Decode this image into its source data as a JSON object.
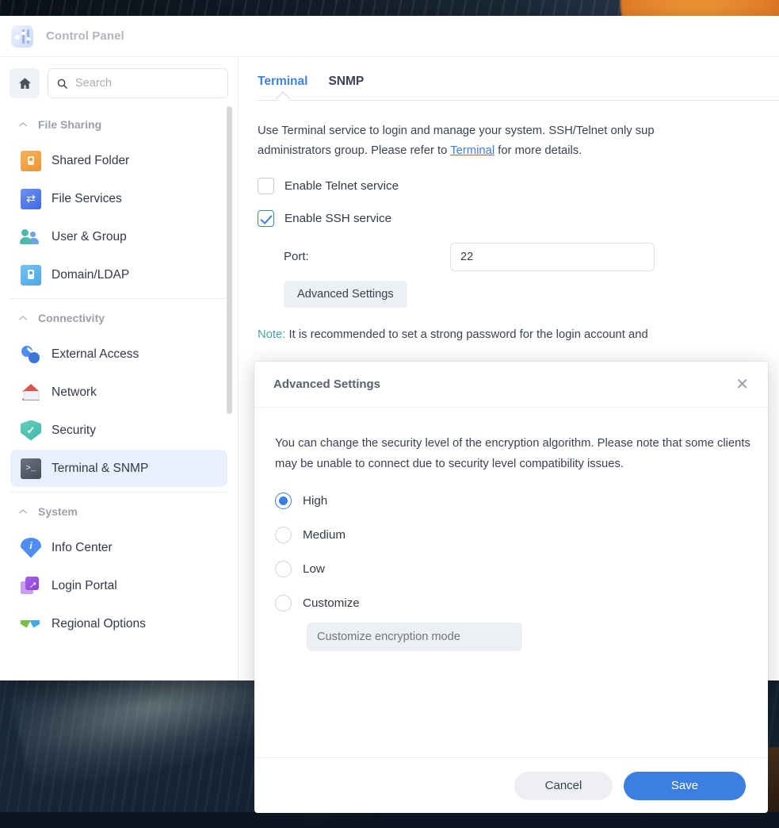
{
  "window": {
    "title": "Control Panel",
    "app_icon": "control-panel-icon"
  },
  "sidebar": {
    "home_icon": "home-icon",
    "search": {
      "placeholder": "Search",
      "value": "",
      "icon": "search-icon"
    },
    "groups": [
      {
        "label": "File Sharing",
        "chevron": "chevron-up-icon",
        "items": [
          {
            "label": "Shared Folder",
            "icon": "shared-folder-icon",
            "selected": false
          },
          {
            "label": "File Services",
            "icon": "file-services-icon",
            "selected": false
          },
          {
            "label": "User & Group",
            "icon": "user-group-icon",
            "selected": false
          },
          {
            "label": "Domain/LDAP",
            "icon": "domain-ldap-icon",
            "selected": false
          }
        ]
      },
      {
        "label": "Connectivity",
        "chevron": "chevron-up-icon",
        "items": [
          {
            "label": "External Access",
            "icon": "external-access-icon",
            "selected": false
          },
          {
            "label": "Network",
            "icon": "network-icon",
            "selected": false
          },
          {
            "label": "Security",
            "icon": "security-shield-icon",
            "selected": false
          },
          {
            "label": "Terminal & SNMP",
            "icon": "terminal-icon",
            "selected": true
          }
        ]
      },
      {
        "label": "System",
        "chevron": "chevron-up-icon",
        "items": [
          {
            "label": "Info Center",
            "icon": "info-center-icon",
            "selected": false
          },
          {
            "label": "Login Portal",
            "icon": "login-portal-icon",
            "selected": false
          },
          {
            "label": "Regional Options",
            "icon": "regional-options-icon",
            "selected": false
          }
        ]
      }
    ]
  },
  "main": {
    "tabs": [
      {
        "label": "Terminal",
        "active": true
      },
      {
        "label": "SNMP",
        "active": false
      }
    ],
    "description_part1": "Use Terminal service to login and manage your system. SSH/Telnet only sup",
    "description_part2": "administrators group. Please refer to ",
    "description_link": "Terminal",
    "description_part3": " for more details.",
    "telnet_checkbox": {
      "label": "Enable Telnet service",
      "checked": false
    },
    "ssh_checkbox": {
      "label": "Enable SSH service",
      "checked": true
    },
    "port": {
      "label": "Port:",
      "value": "22"
    },
    "advanced_button": "Advanced Settings",
    "note_prefix": "Note:",
    "note_text": " It is recommended to set a strong password for the login account and"
  },
  "modal": {
    "title": "Advanced Settings",
    "close_icon": "close-icon",
    "description": "You can change the security level of the encryption algorithm. Please note that some clients may be unable to connect due to security level compatibility issues.",
    "options": [
      {
        "label": "High",
        "selected": true
      },
      {
        "label": "Medium",
        "selected": false
      },
      {
        "label": "Low",
        "selected": false
      },
      {
        "label": "Customize",
        "selected": false
      }
    ],
    "customize_input": {
      "placeholder": "Customize encryption mode",
      "value": ""
    },
    "cancel_label": "Cancel",
    "save_label": "Save"
  },
  "colors": {
    "accent_blue": "#3d7fe0",
    "tab_active": "#4182e4",
    "note_teal": "#46a8a0",
    "selected_nav_bg": "#e9f0fb",
    "link": "#3d7fe0"
  }
}
